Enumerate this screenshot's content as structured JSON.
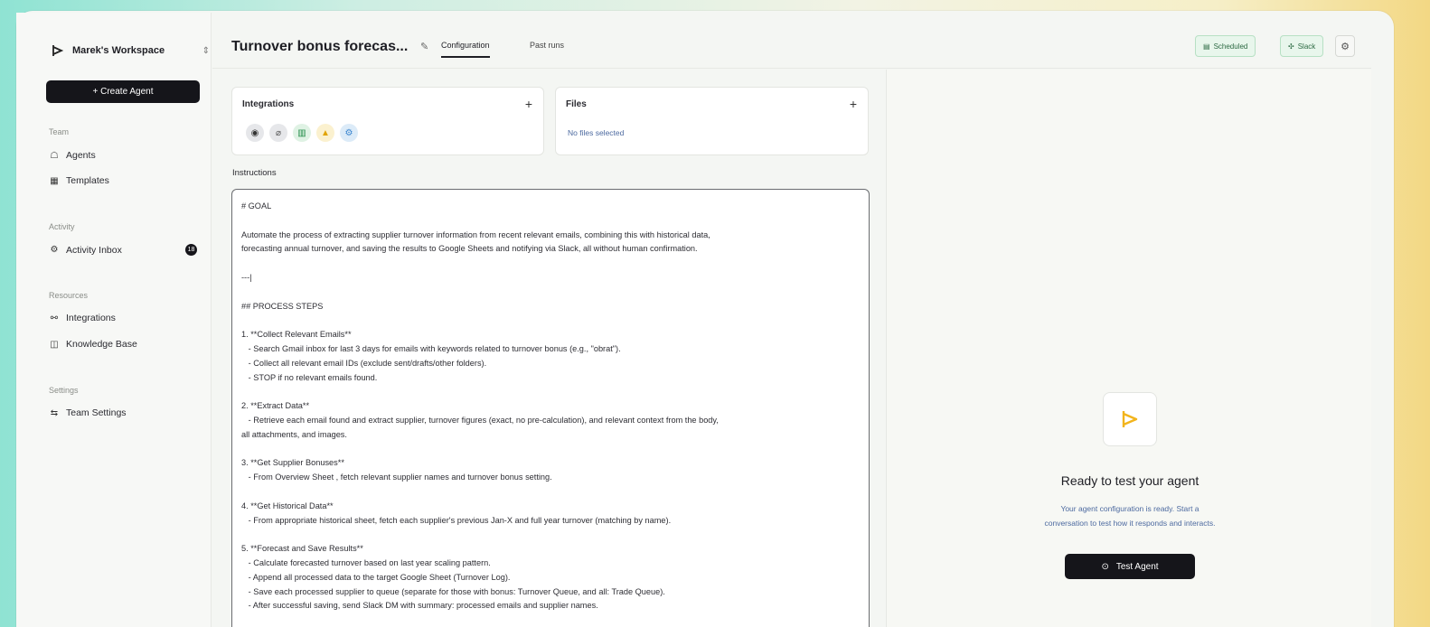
{
  "workspace": {
    "name": "Marek's Workspace"
  },
  "sidebar": {
    "create_label": "+ Create Agent",
    "sections": [
      {
        "label": "Team",
        "items": [
          {
            "label": "Agents",
            "icon": "robot-icon"
          },
          {
            "label": "Templates",
            "icon": "grid-icon"
          }
        ]
      },
      {
        "label": "Activity",
        "items": [
          {
            "label": "Activity Inbox",
            "icon": "inbox-icon",
            "badge": "18"
          }
        ]
      },
      {
        "label": "Resources",
        "items": [
          {
            "label": "Integrations",
            "icon": "plug-icon"
          },
          {
            "label": "Knowledge Base",
            "icon": "book-icon"
          }
        ]
      },
      {
        "label": "Settings",
        "items": [
          {
            "label": "Team Settings",
            "icon": "sliders-icon"
          }
        ]
      }
    ]
  },
  "header": {
    "title": "Turnover bonus forecas...",
    "tabs": [
      "Configuration",
      "Past runs"
    ],
    "scheduled_label": "Scheduled",
    "slack_label": "Slack"
  },
  "integrations": {
    "title": "Integrations",
    "icons": [
      "globe-icon",
      "clip-icon",
      "sheets-icon",
      "drive-icon",
      "gear-icon"
    ]
  },
  "files": {
    "title": "Files",
    "empty": "No files selected"
  },
  "instructions": {
    "label": "Instructions",
    "lines": [
      "# GOAL",
      "",
      "Automate the process of extracting supplier turnover information from recent relevant emails, combining this with historical data,",
      "forecasting annual turnover, and saving the results to Google Sheets and notifying via Slack, all without human confirmation.",
      "",
      "---|",
      "",
      "## PROCESS STEPS",
      "",
      "1. **Collect Relevant Emails**",
      "   - Search Gmail inbox for last 3 days for emails with keywords related to turnover bonus (e.g., \"obrat\").",
      "   - Collect all relevant email IDs (exclude sent/drafts/other folders).",
      "   - STOP if no relevant emails found.",
      "",
      "2. **Extract Data**",
      "   - Retrieve each email found and extract supplier, turnover figures (exact, no pre-calculation), and relevant context from the body,",
      "all attachments, and images.",
      "",
      "3. **Get Supplier Bonuses**",
      "   - From Overview Sheet , fetch relevant supplier names and turnover bonus setting.",
      "",
      "4. **Get Historical Data**",
      "   - From appropriate historical sheet, fetch each supplier's previous Jan-X and full year turnover (matching by name).",
      "",
      "5. **Forecast and Save Results**",
      "   - Calculate forecasted turnover based on last year scaling pattern.",
      "   - Append all processed data to the target Google Sheet (Turnover Log).",
      "   - Save each processed supplier to queue (separate for those with bonus: Turnover Queue, and all: Trade Queue).",
      "   - After successful saving, send Slack DM with summary: processed emails and supplier names."
    ]
  },
  "test_panel": {
    "title": "Ready to test your agent",
    "subtitle_1": "Your agent configuration is ready. Start a",
    "subtitle_2": "conversation to test how it responds and interacts.",
    "button": "Test Agent"
  }
}
